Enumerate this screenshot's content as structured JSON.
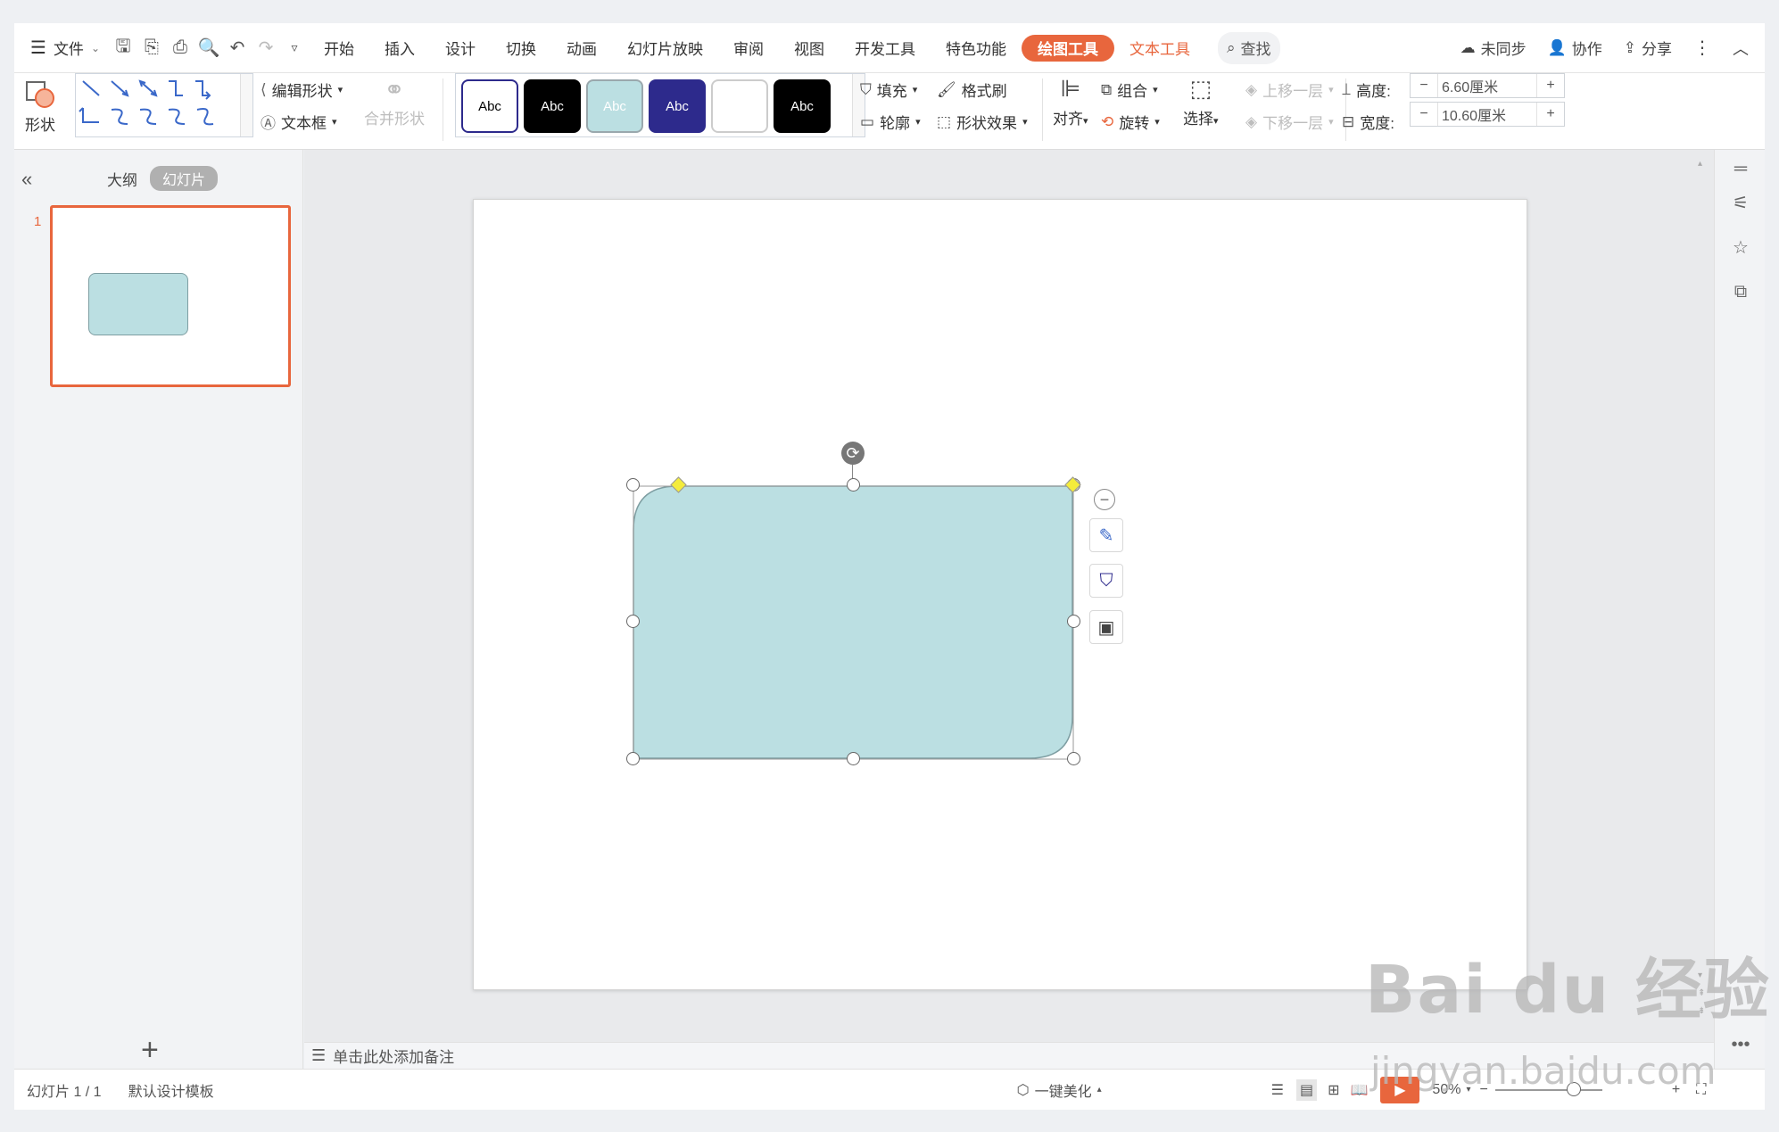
{
  "quick_menu": {
    "file_label": "文件"
  },
  "tabs": [
    "开始",
    "插入",
    "设计",
    "切换",
    "动画",
    "幻灯片放映",
    "审阅",
    "视图",
    "开发工具",
    "特色功能"
  ],
  "context_tabs": {
    "drawing_tools": "绘图工具",
    "text_tools": "文本工具"
  },
  "search_label": "查找",
  "right_tools": {
    "sync": "未同步",
    "collab": "协作",
    "share": "分享"
  },
  "ribbon": {
    "shape_label": "形状",
    "edit_shape": "编辑形状",
    "text_box": "文本框",
    "merge_shape": "合并形状",
    "style_swatches": [
      {
        "text": "Abc",
        "bg": "#ffffff",
        "fg": "#000000",
        "border": "#2d2a8c"
      },
      {
        "text": "Abc",
        "bg": "#000000",
        "fg": "#ffffff",
        "border": "#000000"
      },
      {
        "text": "Abc",
        "bg": "#bbdfe2",
        "fg": "#ffffff",
        "border": "#9aa8ad"
      },
      {
        "text": "Abc",
        "bg": "#2d2a8c",
        "fg": "#ffffff",
        "border": "#2d2a8c"
      },
      {
        "text": "",
        "bg": "#ffffff",
        "fg": "#000000",
        "border": "#cccccc"
      },
      {
        "text": "Abc",
        "bg": "#000000",
        "fg": "#ffffff",
        "border": "#000000"
      }
    ],
    "fill": "填充",
    "format_painter": "格式刷",
    "outline": "轮廓",
    "shape_effects": "形状效果",
    "align": "对齐",
    "group": "组合",
    "rotate": "旋转",
    "select": "选择",
    "bring_forward": "上移一层",
    "send_backward": "下移一层",
    "height_label": "高度:",
    "height_value": "6.60厘米",
    "width_label": "宽度:",
    "width_value": "10.60厘米"
  },
  "left_panel": {
    "outline_tab": "大纲",
    "slides_tab": "幻灯片",
    "slide_number": "1"
  },
  "notes_placeholder": "单击此处添加备注",
  "status": {
    "slide_info": "幻灯片 1 / 1",
    "template": "默认设计模板",
    "beautify": "一键美化",
    "zoom": "50%"
  },
  "shape": {
    "fill": "#bbdfe2",
    "stroke": "#7e9ea2"
  },
  "colors": {
    "accent": "#e8663d"
  },
  "watermark": {
    "logo": "Bai du 经验",
    "url": "jingyan.baidu.com"
  }
}
